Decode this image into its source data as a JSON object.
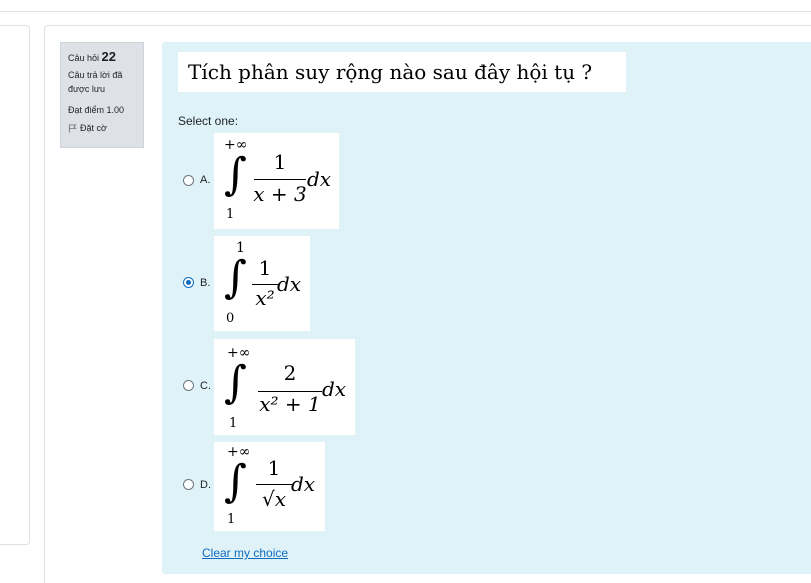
{
  "question": {
    "label": "Câu hỏi",
    "number": "22",
    "state": "Câu trả lời đã được lưu",
    "grade": "Đạt điểm 1.00",
    "flag_label": "Đặt cờ",
    "text": "Tích phân suy rộng nào sau đây hội tụ ?",
    "prompt": "Select one:"
  },
  "options": [
    {
      "letter": "A.",
      "upper": "+∞",
      "lower": "1",
      "numerator": "1",
      "denominator": "x + 3",
      "differential": "dx",
      "checked": false
    },
    {
      "letter": "B.",
      "upper": "1",
      "lower": "0",
      "numerator": "1",
      "denominator": "x²",
      "differential": "dx",
      "checked": true
    },
    {
      "letter": "C.",
      "upper": "+∞",
      "lower": "1",
      "numerator": "2",
      "denominator": "x² + 1",
      "differential": "dx",
      "checked": false
    },
    {
      "letter": "D.",
      "upper": "+∞",
      "lower": "1",
      "numerator": "1",
      "denominator": "√x",
      "differential": "dx",
      "checked": false
    }
  ],
  "clear_label": "Clear my choice",
  "colors": {
    "accent": "#0f6cbf",
    "formulation_bg": "#def2f8",
    "info_bg": "#dee2e6"
  }
}
